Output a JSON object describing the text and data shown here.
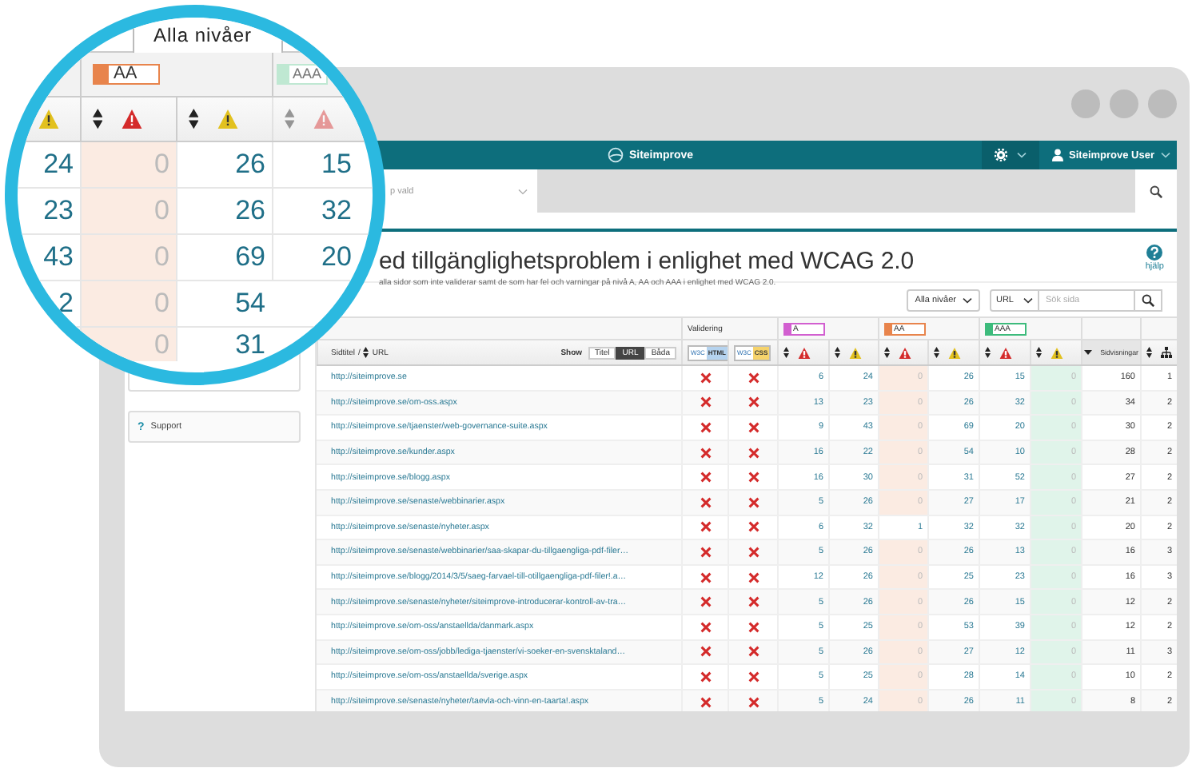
{
  "app": {
    "brand": "Siteimprove",
    "user": "Siteimprove User",
    "group_select": "p vald"
  },
  "sidebar": {
    "support_icon": "?",
    "support": "Support"
  },
  "page": {
    "title": "ed tillgänglighetsproblem i enlighet med WCAG 2.0",
    "subtitle": "alla sidor som inte validerar samt de som har fel och varningar på nivå A, AA och AAA i enlighet med WCAG 2.0.",
    "help": "hjälp"
  },
  "filters": {
    "level": "Alla nivåer",
    "search_by": "URL",
    "search_placeholder": "Sök sida"
  },
  "table": {
    "validation_header": "Validering",
    "levels": [
      {
        "label": "A",
        "color": "#d25fd0"
      },
      {
        "label": "AA",
        "color": "#e8844c"
      },
      {
        "label": "AAA",
        "color": "#3dbb7c"
      }
    ],
    "title_label": "Sidtitel",
    "separator": "/",
    "url_label": "URL",
    "show_label": "Show",
    "display_options": [
      {
        "label": "Titel",
        "selected": false
      },
      {
        "label": "URL",
        "selected": true
      },
      {
        "label": "Båda",
        "selected": false
      }
    ],
    "validators": [
      {
        "logo": "W3C",
        "label": "HTML",
        "color": "#b5d3ef"
      },
      {
        "logo": "W3C",
        "label": "CSS",
        "color": "#f6d36b"
      }
    ],
    "views_header": "Sidvisningar",
    "rows": [
      {
        "url": "http://siteimprove.se",
        "html_valid": false,
        "css_valid": false,
        "counts": [
          "6",
          "24",
          "0",
          "26",
          "15",
          "0"
        ],
        "passed": [
          false,
          false,
          true,
          false,
          false,
          true
        ],
        "views": "160",
        "column_12": "1"
      },
      {
        "url": "http://siteimprove.se/om-oss.aspx",
        "html_valid": false,
        "css_valid": false,
        "counts": [
          "13",
          "23",
          "0",
          "26",
          "32",
          "0"
        ],
        "passed": [
          false,
          false,
          true,
          false,
          false,
          true
        ],
        "views": "34",
        "column_12": "2"
      },
      {
        "url": "http://siteimprove.se/tjaenster/web-governance-suite.aspx",
        "html_valid": false,
        "css_valid": false,
        "counts": [
          "9",
          "43",
          "0",
          "69",
          "20",
          "0"
        ],
        "passed": [
          false,
          false,
          true,
          false,
          false,
          true
        ],
        "views": "30",
        "column_12": "2"
      },
      {
        "url": "http://siteimprove.se/kunder.aspx",
        "html_valid": false,
        "css_valid": false,
        "counts": [
          "16",
          "22",
          "0",
          "54",
          "10",
          "0"
        ],
        "passed": [
          false,
          false,
          true,
          false,
          false,
          true
        ],
        "views": "28",
        "column_12": "2"
      },
      {
        "url": "http://siteimprove.se/blogg.aspx",
        "html_valid": false,
        "css_valid": false,
        "counts": [
          "16",
          "30",
          "0",
          "31",
          "52",
          "0"
        ],
        "passed": [
          false,
          false,
          true,
          false,
          false,
          true
        ],
        "views": "27",
        "column_12": "2"
      },
      {
        "url": "http://siteimprove.se/senaste/webbinarier.aspx",
        "html_valid": false,
        "css_valid": false,
        "counts": [
          "5",
          "26",
          "0",
          "27",
          "17",
          "0"
        ],
        "passed": [
          false,
          false,
          true,
          false,
          false,
          true
        ],
        "views": "21",
        "column_12": "2"
      },
      {
        "url": "http://siteimprove.se/senaste/nyheter.aspx",
        "html_valid": false,
        "css_valid": false,
        "counts": [
          "6",
          "32",
          "1",
          "32",
          "32",
          "0"
        ],
        "passed": [
          false,
          false,
          false,
          false,
          false,
          true
        ],
        "views": "20",
        "column_12": "2"
      },
      {
        "url": "http://siteimprove.se/senaste/webbinarier/saa-skapar-du-tillgaengliga-pdf-filer…",
        "html_valid": false,
        "css_valid": false,
        "counts": [
          "5",
          "26",
          "0",
          "26",
          "13",
          "0"
        ],
        "passed": [
          false,
          false,
          true,
          false,
          false,
          true
        ],
        "views": "16",
        "column_12": "3"
      },
      {
        "url": "http://siteimprove.se/blogg/2014/3/5/saeg-farvael-till-otillgaengliga-pdf-filer!.a…",
        "html_valid": false,
        "css_valid": false,
        "counts": [
          "12",
          "26",
          "0",
          "25",
          "23",
          "0"
        ],
        "passed": [
          false,
          false,
          true,
          false,
          false,
          true
        ],
        "views": "16",
        "column_12": "3"
      },
      {
        "url": "http://siteimprove.se/senaste/nyheter/siteimprove-introducerar-kontroll-av-tra…",
        "html_valid": false,
        "css_valid": false,
        "counts": [
          "5",
          "26",
          "0",
          "26",
          "15",
          "0"
        ],
        "passed": [
          false,
          false,
          true,
          false,
          false,
          true
        ],
        "views": "12",
        "column_12": "2"
      },
      {
        "url": "http://siteimprove.se/om-oss/anstaellda/danmark.aspx",
        "html_valid": false,
        "css_valid": false,
        "counts": [
          "5",
          "25",
          "0",
          "53",
          "39",
          "0"
        ],
        "passed": [
          false,
          false,
          true,
          false,
          false,
          true
        ],
        "views": "12",
        "column_12": "2"
      },
      {
        "url": "http://siteimprove.se/om-oss/jobb/lediga-tjaenster/vi-soeker-en-svensktaland…",
        "html_valid": false,
        "css_valid": false,
        "counts": [
          "5",
          "26",
          "0",
          "27",
          "12",
          "0"
        ],
        "passed": [
          false,
          false,
          true,
          false,
          false,
          true
        ],
        "views": "11",
        "column_12": "3"
      },
      {
        "url": "http://siteimprove.se/om-oss/anstaellda/sverige.aspx",
        "html_valid": false,
        "css_valid": false,
        "counts": [
          "5",
          "25",
          "0",
          "28",
          "14",
          "0"
        ],
        "passed": [
          false,
          false,
          true,
          false,
          false,
          true
        ],
        "views": "10",
        "column_12": "2"
      },
      {
        "url": "http://siteimprove.se/senaste/nyheter/taevla-och-vinn-en-taarta!.aspx",
        "html_valid": false,
        "css_valid": false,
        "counts": [
          "5",
          "24",
          "0",
          "26",
          "11",
          "0"
        ],
        "passed": [
          false,
          false,
          true,
          false,
          false,
          true
        ],
        "views": "8",
        "column_12": "2"
      }
    ]
  },
  "magnifier": {
    "level_filter": "Alla nivåer",
    "levels": [
      {
        "label": "AA",
        "color": "#e8844c"
      },
      {
        "label": "AAA",
        "color": "#bfe8d2"
      }
    ],
    "rows": [
      {
        "cells": [
          "24",
          "0",
          "26",
          "15"
        ],
        "passed": [
          false,
          true,
          false,
          false
        ]
      },
      {
        "cells": [
          "23",
          "0",
          "26",
          "32"
        ],
        "passed": [
          false,
          true,
          false,
          false
        ]
      },
      {
        "cells": [
          "43",
          "0",
          "69",
          "20"
        ],
        "passed": [
          false,
          true,
          false,
          false
        ]
      },
      {
        "cells": [
          "2",
          "0",
          "54"
        ],
        "passed": [
          false,
          true,
          false
        ]
      },
      {
        "cells": [
          "",
          "0",
          "31"
        ],
        "passed": [
          false,
          true,
          false
        ]
      }
    ]
  }
}
